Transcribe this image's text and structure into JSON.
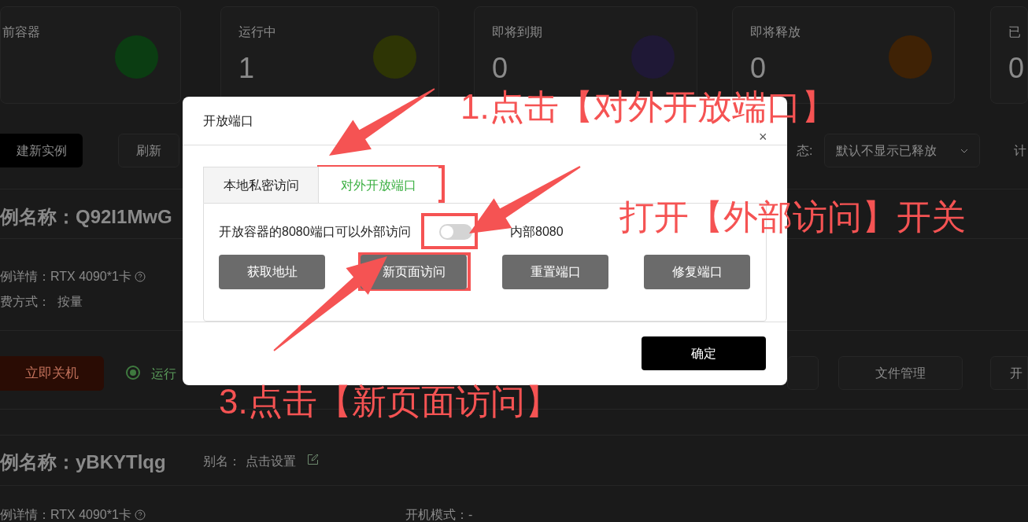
{
  "stat_cards": [
    {
      "label": "前容器",
      "color": "#0b3d12"
    },
    {
      "label": "运行中",
      "value": "1",
      "color": "#2e3505"
    },
    {
      "label": "即将到期",
      "value": "0",
      "color": "#1f1836"
    },
    {
      "label": "即将释放",
      "value": "0",
      "color": "#3f2205"
    },
    {
      "label": "已",
      "value": "0"
    }
  ],
  "toolbar": {
    "create_button": "建新实例",
    "refresh_button": "刷新",
    "status_label": "态:",
    "status_select": "默认不显示已释放",
    "column_6": "计"
  },
  "instances": [
    {
      "name": "例名称：Q92I1MwG",
      "details": "例详情：RTX 4090*1卡",
      "billing": "费方式：  按量",
      "shutdown_button": "立即关机",
      "status": {
        "label": "运行",
        "checked": true
      },
      "file_button": "文件管理",
      "more_button": "开"
    },
    {
      "name": "例名称：yBKYTlqg",
      "alias_label": "别名：",
      "alias_value": "点击设置",
      "details": "例详情：RTX 4090*1卡",
      "boot_mode": "开机模式：-"
    }
  ],
  "dialog": {
    "title": "开放端口",
    "close": "×",
    "tabs": [
      {
        "label": "本地私密访问",
        "selected": false
      },
      {
        "label": "对外开放端口",
        "selected": true
      }
    ],
    "port_text": "开放容器的8080端口可以外部访问",
    "external_access": {
      "on": false
    },
    "internal_port": "内部8080",
    "buttons": [
      "获取地址",
      "新页面访问",
      "重置端口",
      "修复端口"
    ],
    "ok_button": "确定"
  },
  "annotations": [
    "1.点击【对外开放端口】",
    "打开【外部访问】开关",
    "3.点击【新页面访问】"
  ]
}
